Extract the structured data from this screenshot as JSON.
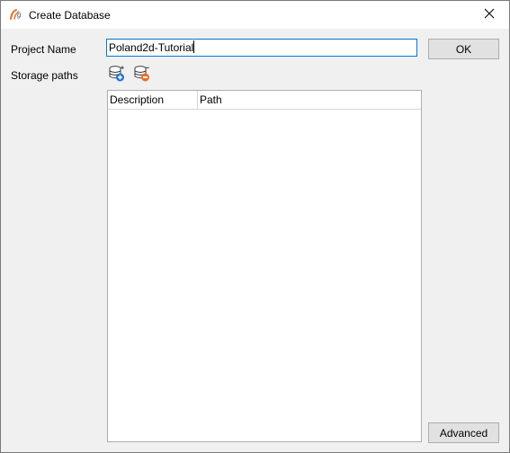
{
  "window": {
    "title": "Create Database",
    "app_icon": "app-logo-icon",
    "close_icon": "close-icon"
  },
  "form": {
    "project_name_label": "Project Name",
    "project_name_value": "Poland2d-Tutorial",
    "storage_paths_label": "Storage paths",
    "add_path_icon": "database-add-icon",
    "remove_path_icon": "database-remove-icon"
  },
  "table": {
    "columns": [
      "Description",
      "Path"
    ],
    "rows": []
  },
  "buttons": {
    "ok_label": "OK",
    "advanced_label": "Advanced"
  }
}
